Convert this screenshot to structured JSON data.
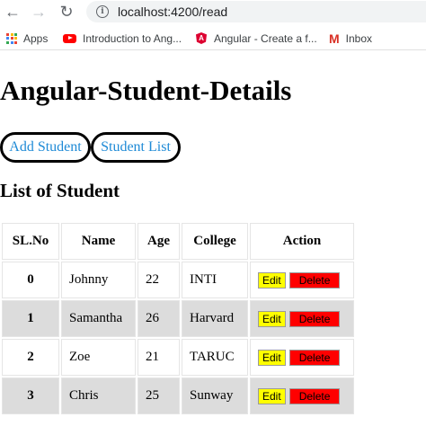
{
  "browser": {
    "url": "localhost:4200/read",
    "bookmarks": [
      {
        "label": "Apps",
        "icon": "apps-grid-icon"
      },
      {
        "label": "Introduction to Ang...",
        "icon": "youtube-icon"
      },
      {
        "label": "Angular - Create a f...",
        "icon": "angular-icon"
      },
      {
        "label": "Inbox",
        "icon": "gmail-icon"
      }
    ]
  },
  "page": {
    "title": "Angular-Student-Details",
    "nav": {
      "add_student": "Add Student",
      "student_list": "Student List"
    },
    "list_title": "List of Student"
  },
  "table": {
    "headers": [
      "SL.No",
      "Name",
      "Age",
      "College",
      "Action"
    ],
    "rows": [
      {
        "sl": "0",
        "name": "Johnny",
        "age": "22",
        "college": "INTI"
      },
      {
        "sl": "1",
        "name": "Samantha",
        "age": "26",
        "college": "Harvard"
      },
      {
        "sl": "2",
        "name": "Zoe",
        "age": "21",
        "college": "TARUC"
      },
      {
        "sl": "3",
        "name": "Chris",
        "age": "25",
        "college": "Sunway"
      }
    ],
    "edit_label": "Edit",
    "delete_label": "Delete"
  },
  "colors": {
    "link": "#1e8ad6",
    "edit": "#ffff00",
    "delete": "#ff0000",
    "row_alt": "#dcdcdc"
  }
}
